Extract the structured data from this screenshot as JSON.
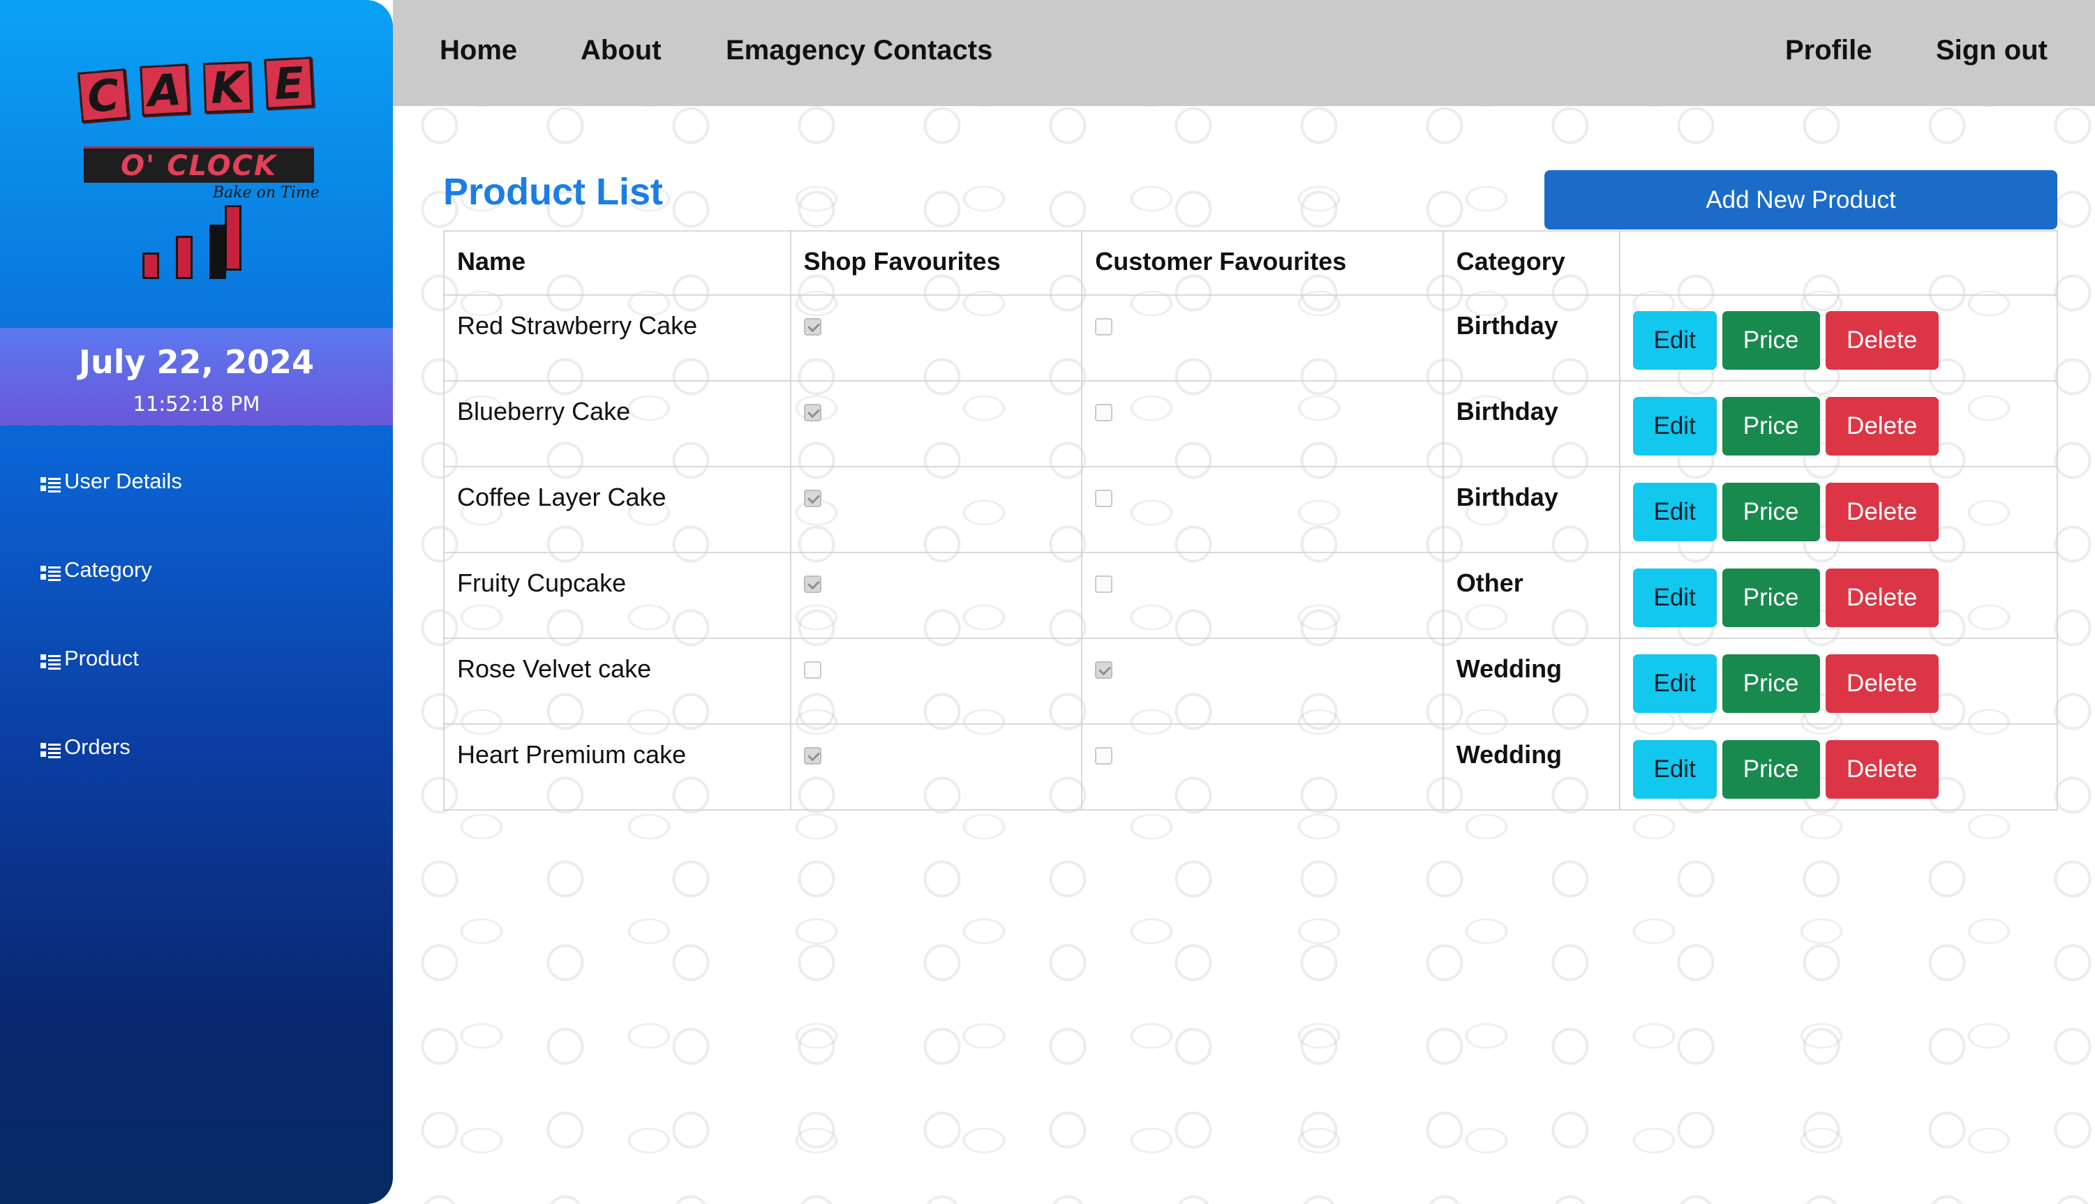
{
  "brand": {
    "logo_letters": [
      "C",
      "A",
      "K",
      "E"
    ],
    "logo_bar_text": "O' CLOCK",
    "logo_tagline": "Bake on Time"
  },
  "datetime": {
    "date": "July 22, 2024",
    "time": "11:52:18 PM"
  },
  "sidebar": {
    "items": [
      {
        "label": "User Details",
        "icon": "list-icon"
      },
      {
        "label": "Category",
        "icon": "list-icon"
      },
      {
        "label": "Product",
        "icon": "list-icon"
      },
      {
        "label": "Orders",
        "icon": "list-icon"
      }
    ]
  },
  "topnav": {
    "home": "Home",
    "about": "About",
    "contacts": "Emagency Contacts",
    "profile": "Profile",
    "signout": "Sign out"
  },
  "main": {
    "title": "Product List",
    "add_button": "Add New Product",
    "table": {
      "headers": [
        "Name",
        "Shop Favourites",
        "Customer Favourites",
        "Category",
        ""
      ],
      "rows": [
        {
          "name": "Red Strawberry Cake",
          "shop_fav": true,
          "customer_fav": false,
          "category": "Birthday"
        },
        {
          "name": "Blueberry Cake",
          "shop_fav": true,
          "customer_fav": false,
          "category": "Birthday"
        },
        {
          "name": "Coffee Layer Cake",
          "shop_fav": true,
          "customer_fav": false,
          "category": "Birthday"
        },
        {
          "name": "Fruity Cupcake",
          "shop_fav": true,
          "customer_fav": false,
          "category": "Other"
        },
        {
          "name": "Rose Velvet cake",
          "shop_fav": false,
          "customer_fav": true,
          "category": "Wedding"
        },
        {
          "name": "Heart Premium cake",
          "shop_fav": true,
          "customer_fav": false,
          "category": "Wedding"
        }
      ],
      "actions": {
        "edit": "Edit",
        "price": "Price",
        "delete": "Delete"
      }
    }
  },
  "colors": {
    "sidebar_top": "#0aa2f5",
    "sidebar_bottom": "#072a63",
    "title_blue": "#1a7ee6",
    "add_button": "#1b6cc8",
    "edit_button": "#12c8ef",
    "price_button": "#198a4e",
    "delete_button": "#dc3646"
  }
}
